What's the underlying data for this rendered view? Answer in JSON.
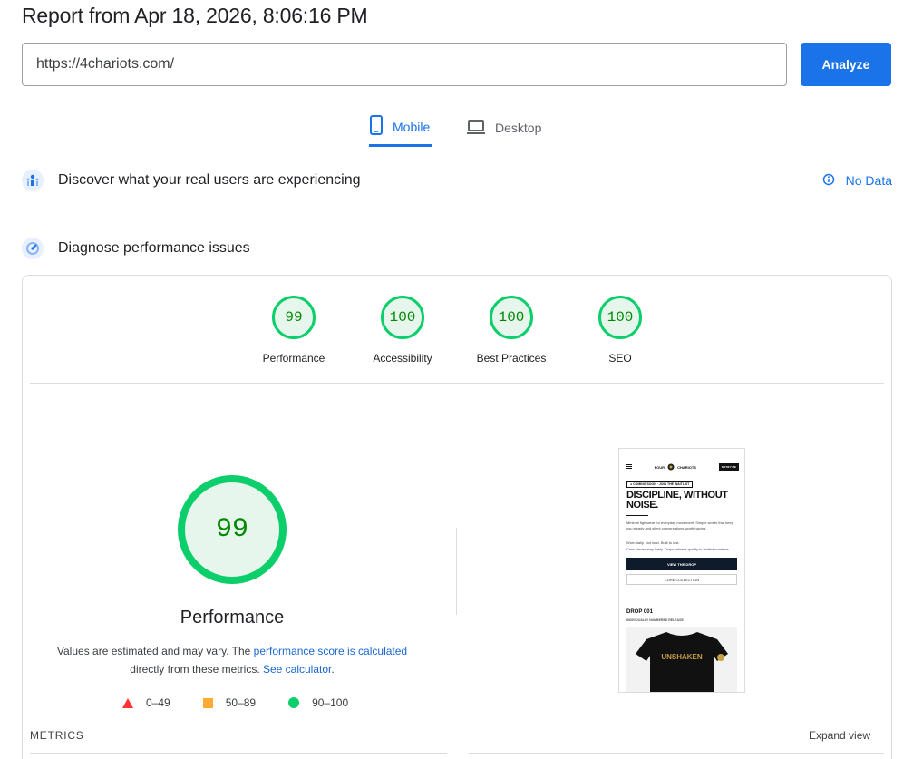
{
  "header": {
    "title": "Report from Apr 18, 2026, 8:06:16 PM"
  },
  "url_bar": {
    "value": "https://4chariots.com/",
    "analyze_label": "Analyze"
  },
  "tabs": [
    {
      "label": "Mobile",
      "active": true,
      "icon": "phone-icon"
    },
    {
      "label": "Desktop",
      "active": false,
      "icon": "laptop-icon"
    }
  ],
  "sections": {
    "real_users": {
      "label": "Discover what your real users are experiencing",
      "status": "No Data",
      "icon": "users-icon"
    },
    "diagnose": {
      "label": "Diagnose performance issues",
      "icon": "gauge-icon"
    }
  },
  "scores": [
    {
      "label": "Performance",
      "value": "99"
    },
    {
      "label": "Accessibility",
      "value": "100"
    },
    {
      "label": "Best Practices",
      "value": "100"
    },
    {
      "label": "SEO",
      "value": "100"
    }
  ],
  "main_score": {
    "value": "99",
    "label": "Performance",
    "note_prefix": "Values are estimated and may vary. The ",
    "note_link": "performance score is calculated",
    "note_middle": " directly from these metrics. ",
    "note_link2": "See calculator",
    "note_suffix": "."
  },
  "legend": [
    {
      "label": "0–49",
      "shape": "triangle",
      "color": "#ff3333"
    },
    {
      "label": "50–89",
      "shape": "square",
      "color": "#ffaa33"
    },
    {
      "label": "90–100",
      "shape": "circle",
      "color": "#0cce6b"
    }
  ],
  "screenshot": {
    "brand_left": "FOUR",
    "brand_right": "CHARIOTS",
    "notify": "NOTIFY ME",
    "pill": "● COMING SOON · JOIN THE WAITLIST",
    "headline": "DISCIPLINE, WITHOUT NOISE.",
    "p1": "Minimal fightwear for everyday movement. Simple words that keep you steady and silent conversations worth having.",
    "p2": "Worn daily. Not loud. Built to last.",
    "p3": "Core pieces stay lively. Drops release quietly in limited numbers.",
    "btn_dark": "VIEW THE DROP",
    "btn_light": "CORE COLLECTION",
    "drop_title": "DROP 001",
    "drop_sub": "INDIVIDUALLY NUMBERED RELEASE",
    "shirt_text": "UNSHAKEN"
  },
  "footer": {
    "metrics_label": "METRICS",
    "expand_label": "Expand view"
  },
  "colors": {
    "accent": "#1a73e8",
    "pass": "#0cce6b",
    "pass_text": "#008800"
  }
}
